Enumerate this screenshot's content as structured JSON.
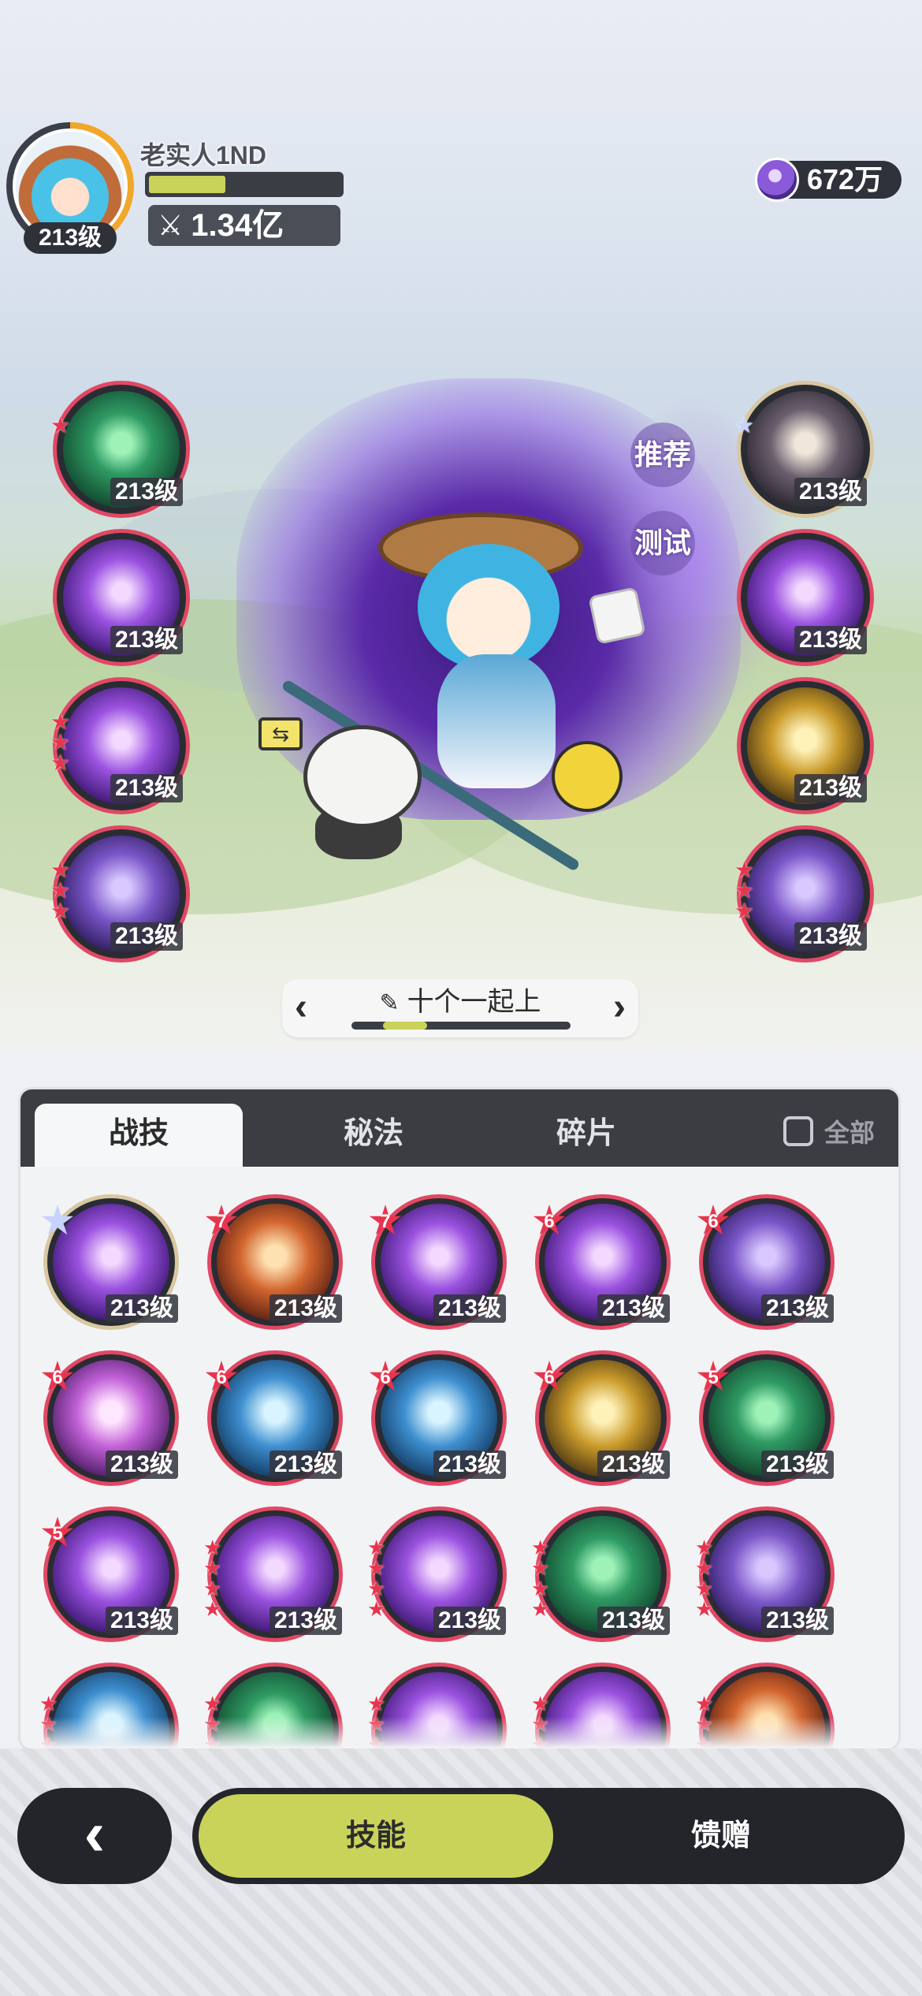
{
  "player": {
    "name": "老实人1ND",
    "level": "213级",
    "power": "1.34亿",
    "exp_fraction": 0.4
  },
  "currency": {
    "amount": "672万",
    "icon": "purple-gem-icon"
  },
  "side_buttons": {
    "recommend": "推荐",
    "test": "测试"
  },
  "left_slots": [
    {
      "level": "213级",
      "stars": 1,
      "theme": "green"
    },
    {
      "level": "213级",
      "stars": 0,
      "theme": "purple"
    },
    {
      "level": "213级",
      "stars": 3,
      "theme": "purple"
    },
    {
      "level": "213级",
      "stars": 3,
      "theme": "violet"
    }
  ],
  "right_slots": [
    {
      "level": "213级",
      "stars": 1,
      "theme": "dark",
      "white_star": true
    },
    {
      "level": "213级",
      "stars": 0,
      "theme": "purple"
    },
    {
      "level": "213级",
      "stars": 0,
      "theme": "gold"
    },
    {
      "level": "213级",
      "stars": 3,
      "theme": "violet"
    }
  ],
  "formation": {
    "label": "十个一起上",
    "scroll_fraction": 0.2
  },
  "panel": {
    "tabs": [
      "战技",
      "秘法",
      "碎片"
    ],
    "active_tab": 0,
    "all_label": "全部"
  },
  "skills": [
    {
      "level": "213级",
      "badge": "",
      "white": true,
      "theme": "purple"
    },
    {
      "level": "213级",
      "badge": "7",
      "theme": "orange"
    },
    {
      "level": "213级",
      "badge": "7",
      "theme": "purple"
    },
    {
      "level": "213级",
      "badge": "6",
      "theme": "purple"
    },
    {
      "level": "213级",
      "badge": "6",
      "theme": "violet"
    },
    {
      "level": "213级",
      "badge": "6",
      "theme": "pink"
    },
    {
      "level": "213级",
      "badge": "6",
      "theme": "blue"
    },
    {
      "level": "213级",
      "badge": "6",
      "theme": "blue"
    },
    {
      "level": "213级",
      "badge": "6",
      "theme": "gold"
    },
    {
      "level": "213级",
      "badge": "5",
      "theme": "green"
    },
    {
      "level": "213级",
      "badge": "5",
      "theme": "purple"
    },
    {
      "level": "213级",
      "badge": "",
      "stars": 4,
      "theme": "purple"
    },
    {
      "level": "213级",
      "badge": "",
      "stars": 4,
      "theme": "purple"
    },
    {
      "level": "213级",
      "badge": "",
      "stars": 4,
      "theme": "green"
    },
    {
      "level": "213级",
      "badge": "",
      "stars": 4,
      "theme": "violet"
    },
    {
      "level": "",
      "badge": "",
      "stars": 4,
      "theme": "blue"
    },
    {
      "level": "",
      "badge": "",
      "stars": 4,
      "theme": "green"
    },
    {
      "level": "",
      "badge": "",
      "stars": 4,
      "theme": "purple"
    },
    {
      "level": "",
      "badge": "",
      "stars": 4,
      "theme": "purple"
    },
    {
      "level": "",
      "badge": "",
      "stars": 4,
      "theme": "orange"
    }
  ],
  "bottom_nav": {
    "back_icon": "chevron-left-icon",
    "skill_label": "技能",
    "gift_label": "馈赠"
  },
  "colors": {
    "accent": "#c9d35a",
    "dark": "#23252b",
    "ring_red": "#e04864",
    "star_red": "#e8344e"
  }
}
